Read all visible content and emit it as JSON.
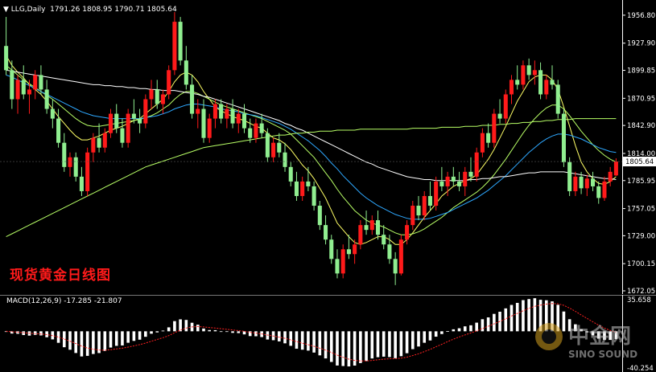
{
  "header": {
    "arrow": "▼",
    "symbol": "LLG,Daily",
    "ohlc": [
      "1791.26",
      "1808.95",
      "1790.71",
      "1805.64"
    ]
  },
  "caption": "现货黄金日线图",
  "macd": {
    "label": "MACD(12,26,9)",
    "signal": "-17.285",
    "histogram": "-21.807"
  },
  "watermark": {
    "cn": "中金网",
    "en": "SINO SOUND"
  },
  "colors": {
    "up": "#ff1a1a",
    "down": "#90ee90",
    "grid": "#333333",
    "axis": "#ffffff",
    "ma_short": "#ffff66",
    "ma_mid1": "#b8ff66",
    "ma_mid2": "#2ea8ff",
    "ma_long1": "#ffffff",
    "ma_long2": "#b8ff66",
    "macd_bar": "#ffffff",
    "macd_signal": "#ff2020"
  },
  "chart_data": {
    "type": "candlestick",
    "ylim": [
      1672.05,
      1970
    ],
    "y_ticks": [
      "1956.80",
      "1927.90",
      "1899.85",
      "1870.95",
      "1842.90",
      "1814.00",
      "1785.95",
      "1757.05",
      "1729.00",
      "1700.15",
      "1672.05"
    ],
    "last_price": "1805.64",
    "candles": [
      [
        1925,
        1955,
        1895,
        1900
      ],
      [
        1900,
        1910,
        1860,
        1870
      ],
      [
        1870,
        1895,
        1855,
        1890
      ],
      [
        1890,
        1905,
        1870,
        1875
      ],
      [
        1875,
        1890,
        1855,
        1880
      ],
      [
        1880,
        1900,
        1870,
        1895
      ],
      [
        1895,
        1905,
        1875,
        1880
      ],
      [
        1880,
        1890,
        1855,
        1860
      ],
      [
        1860,
        1870,
        1840,
        1850
      ],
      [
        1850,
        1860,
        1820,
        1825
      ],
      [
        1825,
        1835,
        1795,
        1800
      ],
      [
        1800,
        1815,
        1790,
        1810
      ],
      [
        1810,
        1815,
        1785,
        1790
      ],
      [
        1790,
        1800,
        1770,
        1775
      ],
      [
        1775,
        1820,
        1770,
        1815
      ],
      [
        1815,
        1835,
        1805,
        1830
      ],
      [
        1830,
        1845,
        1815,
        1820
      ],
      [
        1820,
        1840,
        1815,
        1835
      ],
      [
        1835,
        1860,
        1830,
        1855
      ],
      [
        1855,
        1865,
        1835,
        1840
      ],
      [
        1840,
        1850,
        1820,
        1825
      ],
      [
        1825,
        1860,
        1820,
        1855
      ],
      [
        1855,
        1870,
        1845,
        1850
      ],
      [
        1850,
        1860,
        1835,
        1845
      ],
      [
        1845,
        1875,
        1840,
        1870
      ],
      [
        1870,
        1890,
        1860,
        1880
      ],
      [
        1880,
        1890,
        1860,
        1865
      ],
      [
        1865,
        1880,
        1855,
        1875
      ],
      [
        1875,
        1905,
        1870,
        1900
      ],
      [
        1900,
        1960,
        1895,
        1950
      ],
      [
        1950,
        1955,
        1905,
        1910
      ],
      [
        1910,
        1925,
        1880,
        1885
      ],
      [
        1885,
        1895,
        1850,
        1855
      ],
      [
        1855,
        1870,
        1840,
        1860
      ],
      [
        1860,
        1870,
        1825,
        1830
      ],
      [
        1830,
        1855,
        1825,
        1850
      ],
      [
        1850,
        1870,
        1840,
        1865
      ],
      [
        1865,
        1870,
        1845,
        1850
      ],
      [
        1850,
        1865,
        1840,
        1860
      ],
      [
        1860,
        1870,
        1840,
        1845
      ],
      [
        1845,
        1860,
        1835,
        1855
      ],
      [
        1855,
        1865,
        1835,
        1840
      ],
      [
        1840,
        1850,
        1825,
        1830
      ],
      [
        1830,
        1850,
        1825,
        1845
      ],
      [
        1845,
        1855,
        1830,
        1835
      ],
      [
        1835,
        1840,
        1805,
        1810
      ],
      [
        1810,
        1830,
        1805,
        1825
      ],
      [
        1825,
        1835,
        1810,
        1815
      ],
      [
        1815,
        1825,
        1795,
        1800
      ],
      [
        1800,
        1805,
        1780,
        1785
      ],
      [
        1785,
        1795,
        1765,
        1770
      ],
      [
        1770,
        1790,
        1765,
        1785
      ],
      [
        1785,
        1800,
        1775,
        1780
      ],
      [
        1780,
        1785,
        1755,
        1760
      ],
      [
        1760,
        1765,
        1735,
        1740
      ],
      [
        1740,
        1750,
        1720,
        1725
      ],
      [
        1725,
        1730,
        1700,
        1705
      ],
      [
        1705,
        1715,
        1685,
        1690
      ],
      [
        1690,
        1720,
        1685,
        1715
      ],
      [
        1715,
        1730,
        1705,
        1710
      ],
      [
        1710,
        1725,
        1700,
        1720
      ],
      [
        1720,
        1745,
        1715,
        1740
      ],
      [
        1740,
        1755,
        1730,
        1735
      ],
      [
        1735,
        1750,
        1730,
        1745
      ],
      [
        1745,
        1755,
        1725,
        1730
      ],
      [
        1730,
        1740,
        1715,
        1720
      ],
      [
        1720,
        1730,
        1700,
        1705
      ],
      [
        1705,
        1712,
        1678,
        1690
      ],
      [
        1690,
        1730,
        1688,
        1725
      ],
      [
        1725,
        1745,
        1720,
        1740
      ],
      [
        1740,
        1765,
        1735,
        1760
      ],
      [
        1760,
        1770,
        1745,
        1750
      ],
      [
        1750,
        1775,
        1745,
        1770
      ],
      [
        1770,
        1785,
        1755,
        1760
      ],
      [
        1760,
        1790,
        1755,
        1785
      ],
      [
        1785,
        1800,
        1775,
        1780
      ],
      [
        1780,
        1795,
        1770,
        1790
      ],
      [
        1790,
        1800,
        1780,
        1785
      ],
      [
        1785,
        1795,
        1775,
        1780
      ],
      [
        1780,
        1800,
        1770,
        1795
      ],
      [
        1795,
        1810,
        1785,
        1790
      ],
      [
        1790,
        1820,
        1785,
        1815
      ],
      [
        1815,
        1840,
        1810,
        1835
      ],
      [
        1835,
        1845,
        1820,
        1825
      ],
      [
        1825,
        1860,
        1820,
        1855
      ],
      [
        1855,
        1870,
        1845,
        1850
      ],
      [
        1850,
        1880,
        1845,
        1875
      ],
      [
        1875,
        1895,
        1865,
        1890
      ],
      [
        1890,
        1905,
        1880,
        1885
      ],
      [
        1885,
        1910,
        1880,
        1905
      ],
      [
        1905,
        1912,
        1890,
        1895
      ],
      [
        1895,
        1910,
        1885,
        1900
      ],
      [
        1900,
        1908,
        1870,
        1875
      ],
      [
        1875,
        1895,
        1870,
        1890
      ],
      [
        1890,
        1905,
        1880,
        1885
      ],
      [
        1885,
        1890,
        1850,
        1855
      ],
      [
        1855,
        1860,
        1800,
        1805
      ],
      [
        1805,
        1810,
        1770,
        1775
      ],
      [
        1775,
        1795,
        1770,
        1790
      ],
      [
        1790,
        1795,
        1772,
        1778
      ],
      [
        1778,
        1792,
        1770,
        1788
      ],
      [
        1788,
        1795,
        1775,
        1780
      ],
      [
        1780,
        1785,
        1762,
        1768
      ],
      [
        1768,
        1790,
        1765,
        1785
      ],
      [
        1785,
        1800,
        1780,
        1795
      ],
      [
        1791.26,
        1808.95,
        1790.71,
        1805.64
      ]
    ],
    "moving_averages": [
      {
        "values": [
          1915,
          1905,
          1898,
          1892,
          1885,
          1880,
          1875,
          1868,
          1860,
          1852,
          1845,
          1838,
          1832,
          1828,
          1828,
          1830,
          1832,
          1835,
          1838,
          1840,
          1842,
          1845,
          1848,
          1850,
          1855,
          1860,
          1865,
          1870,
          1878,
          1888,
          1895,
          1898,
          1895,
          1888,
          1878,
          1870,
          1862,
          1858,
          1855,
          1852,
          1850,
          1848,
          1845,
          1842,
          1840,
          1835,
          1830,
          1828,
          1824,
          1818,
          1810,
          1802,
          1796,
          1788,
          1778,
          1768,
          1755,
          1742,
          1735,
          1728,
          1722,
          1720,
          1722,
          1725,
          1728,
          1728,
          1725,
          1720,
          1720,
          1725,
          1732,
          1740,
          1748,
          1755,
          1762,
          1770,
          1775,
          1780,
          1783,
          1786,
          1788,
          1792,
          1800,
          1808,
          1818,
          1830,
          1842,
          1855,
          1868,
          1878,
          1888,
          1893,
          1895,
          1895,
          1890,
          1880,
          1862,
          1842,
          1822,
          1805,
          1795,
          1788,
          1783,
          1782,
          1785,
          1790
        ]
      },
      {
        "values": [
          1905,
          1900,
          1895,
          1890,
          1886,
          1882,
          1878,
          1874,
          1870,
          1865,
          1860,
          1855,
          1850,
          1846,
          1843,
          1842,
          1842,
          1843,
          1844,
          1845,
          1846,
          1847,
          1848,
          1849,
          1851,
          1853,
          1856,
          1860,
          1864,
          1870,
          1875,
          1878,
          1878,
          1876,
          1873,
          1870,
          1867,
          1864,
          1862,
          1860,
          1858,
          1856,
          1854,
          1852,
          1850,
          1847,
          1844,
          1841,
          1838,
          1834,
          1828,
          1822,
          1816,
          1810,
          1802,
          1794,
          1786,
          1777,
          1769,
          1762,
          1755,
          1750,
          1745,
          1742,
          1740,
          1738,
          1735,
          1732,
          1730,
          1730,
          1731,
          1733,
          1736,
          1740,
          1744,
          1748,
          1753,
          1758,
          1762,
          1766,
          1770,
          1774,
          1779,
          1785,
          1792,
          1800,
          1808,
          1817,
          1826,
          1835,
          1843,
          1850,
          1856,
          1861,
          1864,
          1864,
          1860,
          1853,
          1845,
          1837,
          1830,
          1823,
          1817,
          1812,
          1808,
          1805
        ]
      },
      {
        "values": [
          1895,
          1893,
          1890,
          1887,
          1884,
          1881,
          1878,
          1875,
          1872,
          1869,
          1866,
          1863,
          1860,
          1857,
          1855,
          1853,
          1852,
          1851,
          1850,
          1850,
          1850,
          1850,
          1850,
          1850,
          1851,
          1852,
          1853,
          1855,
          1857,
          1860,
          1862,
          1864,
          1865,
          1865,
          1864,
          1863,
          1862,
          1860,
          1859,
          1858,
          1857,
          1855,
          1854,
          1853,
          1851,
          1849,
          1847,
          1845,
          1842,
          1839,
          1835,
          1831,
          1827,
          1822,
          1817,
          1811,
          1804,
          1798,
          1791,
          1785,
          1779,
          1773,
          1768,
          1764,
          1760,
          1757,
          1754,
          1751,
          1749,
          1747,
          1746,
          1746,
          1746,
          1747,
          1749,
          1751,
          1753,
          1756,
          1759,
          1762,
          1765,
          1768,
          1772,
          1776,
          1781,
          1786,
          1791,
          1797,
          1803,
          1809,
          1815,
          1820,
          1825,
          1829,
          1832,
          1834,
          1834,
          1833,
          1831,
          1829,
          1826,
          1823,
          1820,
          1818,
          1816,
          1815
        ]
      },
      {
        "values": [
          1900,
          1899,
          1898,
          1897,
          1896,
          1895,
          1894,
          1893,
          1892,
          1891,
          1890,
          1889,
          1888,
          1887,
          1886,
          1885,
          1885,
          1884,
          1884,
          1883,
          1883,
          1882,
          1882,
          1881,
          1881,
          1880,
          1880,
          1879,
          1879,
          1879,
          1878,
          1877,
          1876,
          1875,
          1873,
          1872,
          1870,
          1868,
          1866,
          1864,
          1862,
          1860,
          1858,
          1856,
          1854,
          1852,
          1850,
          1848,
          1845,
          1843,
          1840,
          1838,
          1835,
          1832,
          1829,
          1826,
          1823,
          1820,
          1817,
          1814,
          1811,
          1808,
          1805,
          1803,
          1800,
          1798,
          1796,
          1794,
          1792,
          1790,
          1789,
          1788,
          1787,
          1787,
          1786,
          1786,
          1786,
          1786,
          1786,
          1786,
          1787,
          1787,
          1788,
          1788,
          1789,
          1790,
          1790,
          1791,
          1792,
          1793,
          1794,
          1794,
          1795,
          1795,
          1795,
          1795,
          1795,
          1794,
          1793,
          1792,
          1791,
          1790,
          1789,
          1788,
          1788,
          1787
        ]
      },
      {
        "values": [
          1728,
          1731,
          1734,
          1737,
          1740,
          1743,
          1746,
          1749,
          1752,
          1755,
          1758,
          1761,
          1764,
          1767,
          1770,
          1773,
          1776,
          1779,
          1782,
          1785,
          1788,
          1791,
          1794,
          1797,
          1800,
          1802,
          1804,
          1806,
          1808,
          1810,
          1812,
          1814,
          1816,
          1818,
          1820,
          1821,
          1822,
          1823,
          1824,
          1825,
          1826,
          1827,
          1828,
          1829,
          1830,
          1831,
          1832,
          1833,
          1833,
          1834,
          1835,
          1835,
          1836,
          1836,
          1837,
          1837,
          1837,
          1838,
          1838,
          1838,
          1838,
          1839,
          1839,
          1839,
          1839,
          1839,
          1839,
          1839,
          1839,
          1839,
          1840,
          1840,
          1840,
          1840,
          1840,
          1841,
          1841,
          1841,
          1841,
          1842,
          1842,
          1842,
          1843,
          1843,
          1843,
          1844,
          1844,
          1845,
          1845,
          1846,
          1846,
          1847,
          1847,
          1848,
          1848,
          1849,
          1849,
          1849,
          1850,
          1850,
          1850,
          1850,
          1850,
          1850,
          1850,
          1850
        ]
      }
    ],
    "macd": {
      "ylim": [
        -40.254,
        35.658
      ],
      "y_ticks": [
        "35.658",
        "-40.254"
      ]
    }
  }
}
